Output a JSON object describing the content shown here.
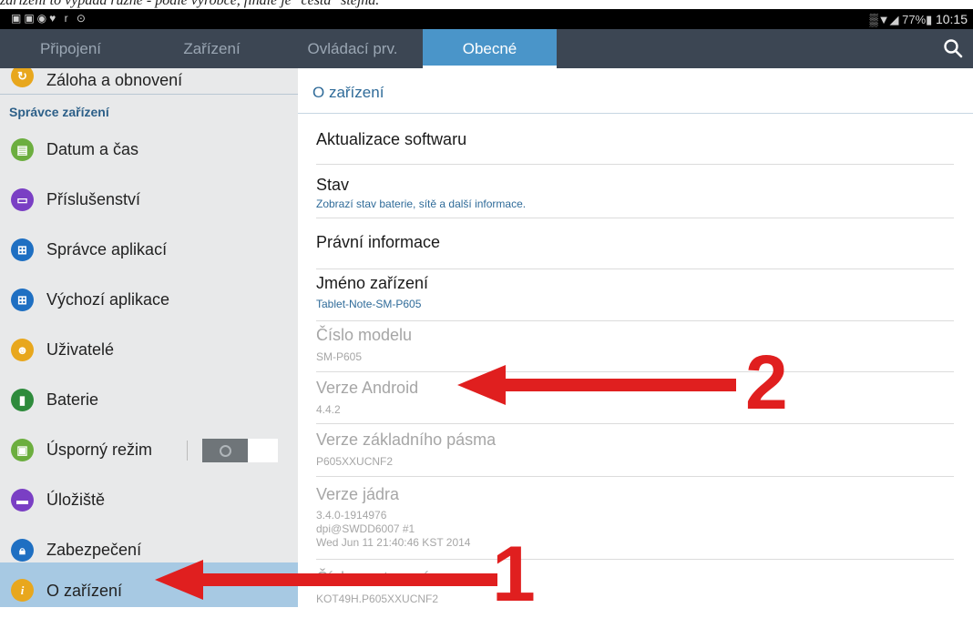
{
  "caption": "zařízení to vypadá různě - podle výrobce, finále je \"cesta\" stejná.",
  "status_bar": {
    "left_icons": "▣▣◉♥ r ⊙",
    "right_icons": "▒▼◢ 77%▮",
    "time": "10:15"
  },
  "tabs": [
    {
      "label": "Připojení"
    },
    {
      "label": "Zařízení"
    },
    {
      "label": "Ovládací prv."
    },
    {
      "label": "Obecné"
    }
  ],
  "sidebar": {
    "partial_label": "Záloha a obnovení",
    "section_label": "Správce zařízení",
    "items": [
      {
        "label": "Datum a čas",
        "icon": "calendar-icon",
        "color": "#6cae3f"
      },
      {
        "label": "Příslušenství",
        "icon": "accessory-icon",
        "color": "#7a3fc4"
      },
      {
        "label": "Správce aplikací",
        "icon": "apps-grid-icon",
        "color": "#1e6fc2"
      },
      {
        "label": "Výchozí aplikace",
        "icon": "default-apps-icon",
        "color": "#1e6fc2"
      },
      {
        "label": "Uživatelé",
        "icon": "users-icon",
        "color": "#e8a71d"
      },
      {
        "label": "Baterie",
        "icon": "battery-icon",
        "color": "#2e8b3c"
      },
      {
        "label": "Úsporný režim",
        "icon": "power-saving-icon",
        "color": "#6cae3f"
      },
      {
        "label": "Úložiště",
        "icon": "storage-icon",
        "color": "#7a3fc4"
      },
      {
        "label": "Zabezpečení",
        "icon": "lock-icon",
        "color": "#1e6fc2"
      },
      {
        "label": "O zařízení",
        "icon": "info-icon",
        "color": "#e8a71d"
      }
    ],
    "selected": "O zařízení"
  },
  "content": {
    "heading": "O zařízení",
    "rows": [
      {
        "title": "Aktualizace softwaru",
        "subtitle": ""
      },
      {
        "title": "Stav",
        "subtitle": "Zobrazí stav baterie, sítě a další informace."
      },
      {
        "title": "Právní informace",
        "subtitle": ""
      },
      {
        "title": "Jméno zařízení",
        "subtitle": "Tablet-Note-SM-P605"
      },
      {
        "title": "Číslo modelu",
        "subtitle": "SM-P605"
      },
      {
        "title": "Verze Android",
        "subtitle": "4.4.2"
      },
      {
        "title": "Verze základního pásma",
        "subtitle": "P605XXUCNF2"
      },
      {
        "title": "Verze jádra",
        "subtitle": "3.4.0-1914976",
        "subtitle2": "dpi@SWDD6007 #1",
        "subtitle3": "Wed Jun 11 21:40:46 KST 2014"
      },
      {
        "title": "Číslo sestavení",
        "subtitle": "KOT49H.P605XXUCNF2"
      }
    ]
  },
  "annotations": {
    "first_number": "1",
    "second_number": "2",
    "color": "#e01f1f"
  }
}
